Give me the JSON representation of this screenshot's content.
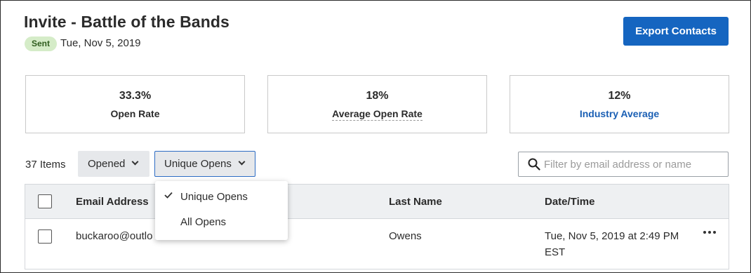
{
  "header": {
    "title": "Invite - Battle of the Bands",
    "status_badge": "Sent",
    "sent_date": "Tue, Nov 5, 2019",
    "export_label": "Export Contacts"
  },
  "stats": [
    {
      "value": "33.3%",
      "label": "Open Rate"
    },
    {
      "value": "18%",
      "label": "Average Open Rate"
    },
    {
      "value": "12%",
      "label": "Industry Average"
    }
  ],
  "toolbar": {
    "items_count": "37 Items",
    "status_filter": "Opened",
    "opens_filter": "Unique Opens",
    "search_placeholder": "Filter by email address or name"
  },
  "dropdown": {
    "options": [
      "Unique Opens",
      "All Opens"
    ],
    "selected": "Unique Opens"
  },
  "table": {
    "columns": [
      "Email Address",
      "Last Name",
      "Date/Time"
    ],
    "rows": [
      {
        "email": "buckaroo@outlo",
        "last_name": "Owens",
        "datetime_line1": "Tue, Nov 5, 2019 at 2:49 PM",
        "datetime_line2": "EST"
      }
    ]
  },
  "colors": {
    "primary": "#1565c0",
    "link": "#1a5fb4",
    "badge_bg": "#d5ecc8",
    "header_bg": "#eef0f2"
  }
}
